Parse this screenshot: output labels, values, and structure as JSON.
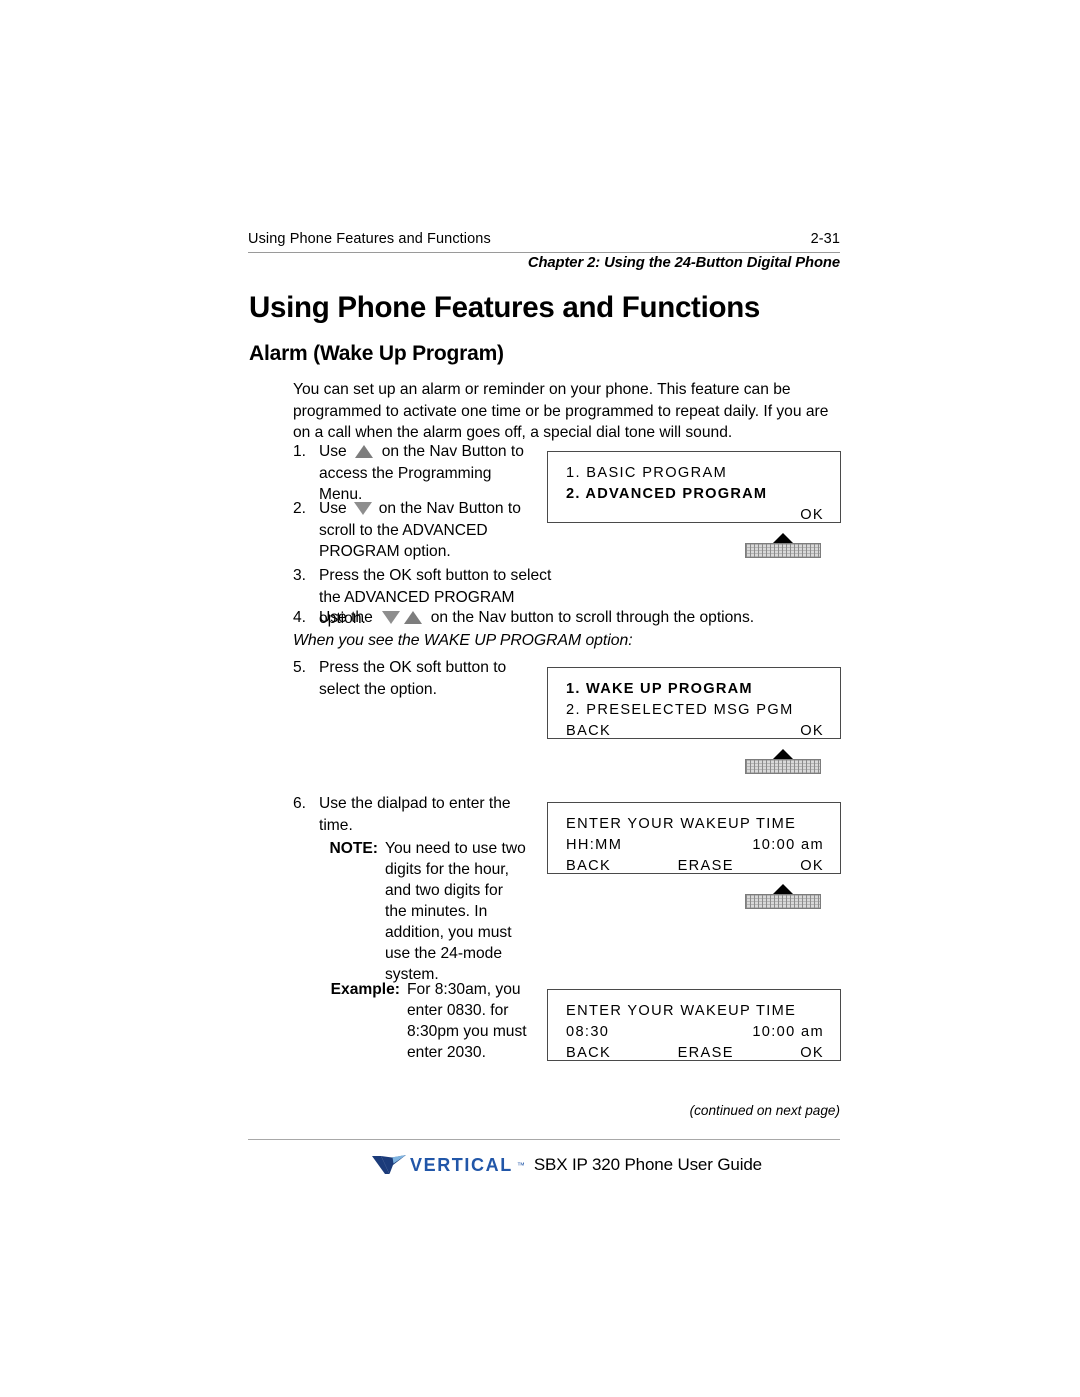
{
  "header": {
    "running_title": "Using Phone Features and Functions",
    "page_number": "2-31",
    "chapter_line": "Chapter 2: Using the 24-Button Digital Phone"
  },
  "titles": {
    "h1": "Using Phone Features and Functions",
    "h2": "Alarm (Wake Up Program)"
  },
  "intro": "You can set up an alarm or reminder on your phone. This feature can be programmed to activate one time or be programmed to repeat daily. If you are on a call when the alarm goes off, a special dial tone will sound.",
  "steps": {
    "s1_num": "1.",
    "s1_a": "Use",
    "s1_b": "on the Nav Button to access the Programming Menu.",
    "s2_num": "2.",
    "s2_a": "Use",
    "s2_b": "on the Nav Button to scroll to the ADVANCED PROGRAM option.",
    "s3_num": "3.",
    "s3_text": "Press the OK soft button to select the ADVANCED PROGRAM option.",
    "s4_num": "4.",
    "s4_a": "Use the",
    "s4_b": "on the Nav button to scroll through the options.",
    "s5_num": "5.",
    "s5_text": "Press the OK soft button to select the option.",
    "s6_num": "6.",
    "s6_text": "Use the dialpad to enter the time."
  },
  "when_line": "When you see the WAKE UP PROGRAM option:",
  "note": {
    "label": "NOTE:",
    "body": "You need to use two digits for the hour, and two digits for the minutes. In addition, you must use the 24-mode system."
  },
  "example": {
    "label": "Example:",
    "body": "For 8:30am, you enter 0830. for 8:30pm you must enter 2030."
  },
  "lcd1": {
    "line1_left": "1. BASIC PROGRAM",
    "line2_left": "2. ADVANCED PROGRAM",
    "line3_right": "OK"
  },
  "lcd2": {
    "line1_left": "1. WAKE UP PROGRAM",
    "line2_left": "2. PRESELECTED MSG PGM",
    "line3_left": "BACK",
    "line3_right": "OK"
  },
  "lcd3": {
    "line1": "ENTER YOUR WAKEUP TIME",
    "line2_left": "HH:MM",
    "line2_right": "10:00 am",
    "line3_left": "BACK",
    "line3_center": "ERASE",
    "line3_right": "OK"
  },
  "lcd4": {
    "line1": "ENTER YOUR WAKEUP TIME",
    "line2_left": "08:30",
    "line2_right": "10:00 am",
    "line3_left": "BACK",
    "line3_center": "ERASE",
    "line3_right": "OK"
  },
  "footer": {
    "continued": "(continued on next page)",
    "logo_text": "VERTICAL",
    "logo_tm": "™",
    "guide_title": "SBX IP 320 Phone User Guide",
    "logo_color_dark": "#1b3b7a",
    "logo_color_light": "#7fb4e0",
    "logo_text_color": "#2156a8"
  }
}
